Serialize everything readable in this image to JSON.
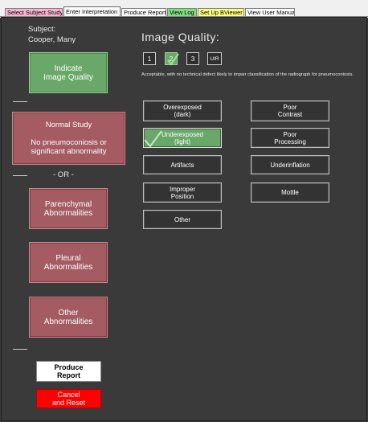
{
  "tabs": [
    {
      "label": "Select Subject Study",
      "bg": "#f9b5d0"
    },
    {
      "label": "Enter Interpretation",
      "bg": "#ffffff"
    },
    {
      "label": "Produce Report",
      "bg": "#ffffff"
    },
    {
      "label": "View Log",
      "bg": "#7de07d"
    },
    {
      "label": "Set Up BViewer",
      "bg": "#ffff80"
    },
    {
      "label": "View User Manual",
      "bg": "#ffffff"
    }
  ],
  "subject": {
    "label": "Subject:",
    "name": "Cooper, Many"
  },
  "left": {
    "indicate_quality": "Indicate\nImage Quality",
    "normal_study": "Normal  Study\n\nNo pneumoconiosis or\nsignificant abnormality",
    "or_label": "- OR -",
    "parenchymal": "Parenchymal\nAbnormalities",
    "pleural": "Pleural\nAbnormalities",
    "other": "Other\nAbnormalities",
    "produce_report": "Produce\nReport",
    "cancel_reset": "Cancel\nand Reset"
  },
  "quality": {
    "title": "Image Quality:",
    "grades": [
      "1",
      "2",
      "3",
      "U/R"
    ],
    "selected_grade": "2",
    "description": "Acceptable, with no technical defect likely to impair classification of the radiograph for pneumoconiosis.",
    "defects_left": [
      "Overexposed\n(dark)",
      "Underexposed\n(light)",
      "Artifacts",
      "Improper\nPosition",
      "Other"
    ],
    "defects_right": [
      "Poor\nContrast",
      "Poor\nProcessing",
      "Underinflation",
      "Mottle"
    ],
    "selected_defect": "Underexposed\n(light)"
  },
  "colors": {
    "accent_green": "#6aa86a",
    "abnormal_red": "#a45b62",
    "cancel_red": "#ff0000"
  }
}
